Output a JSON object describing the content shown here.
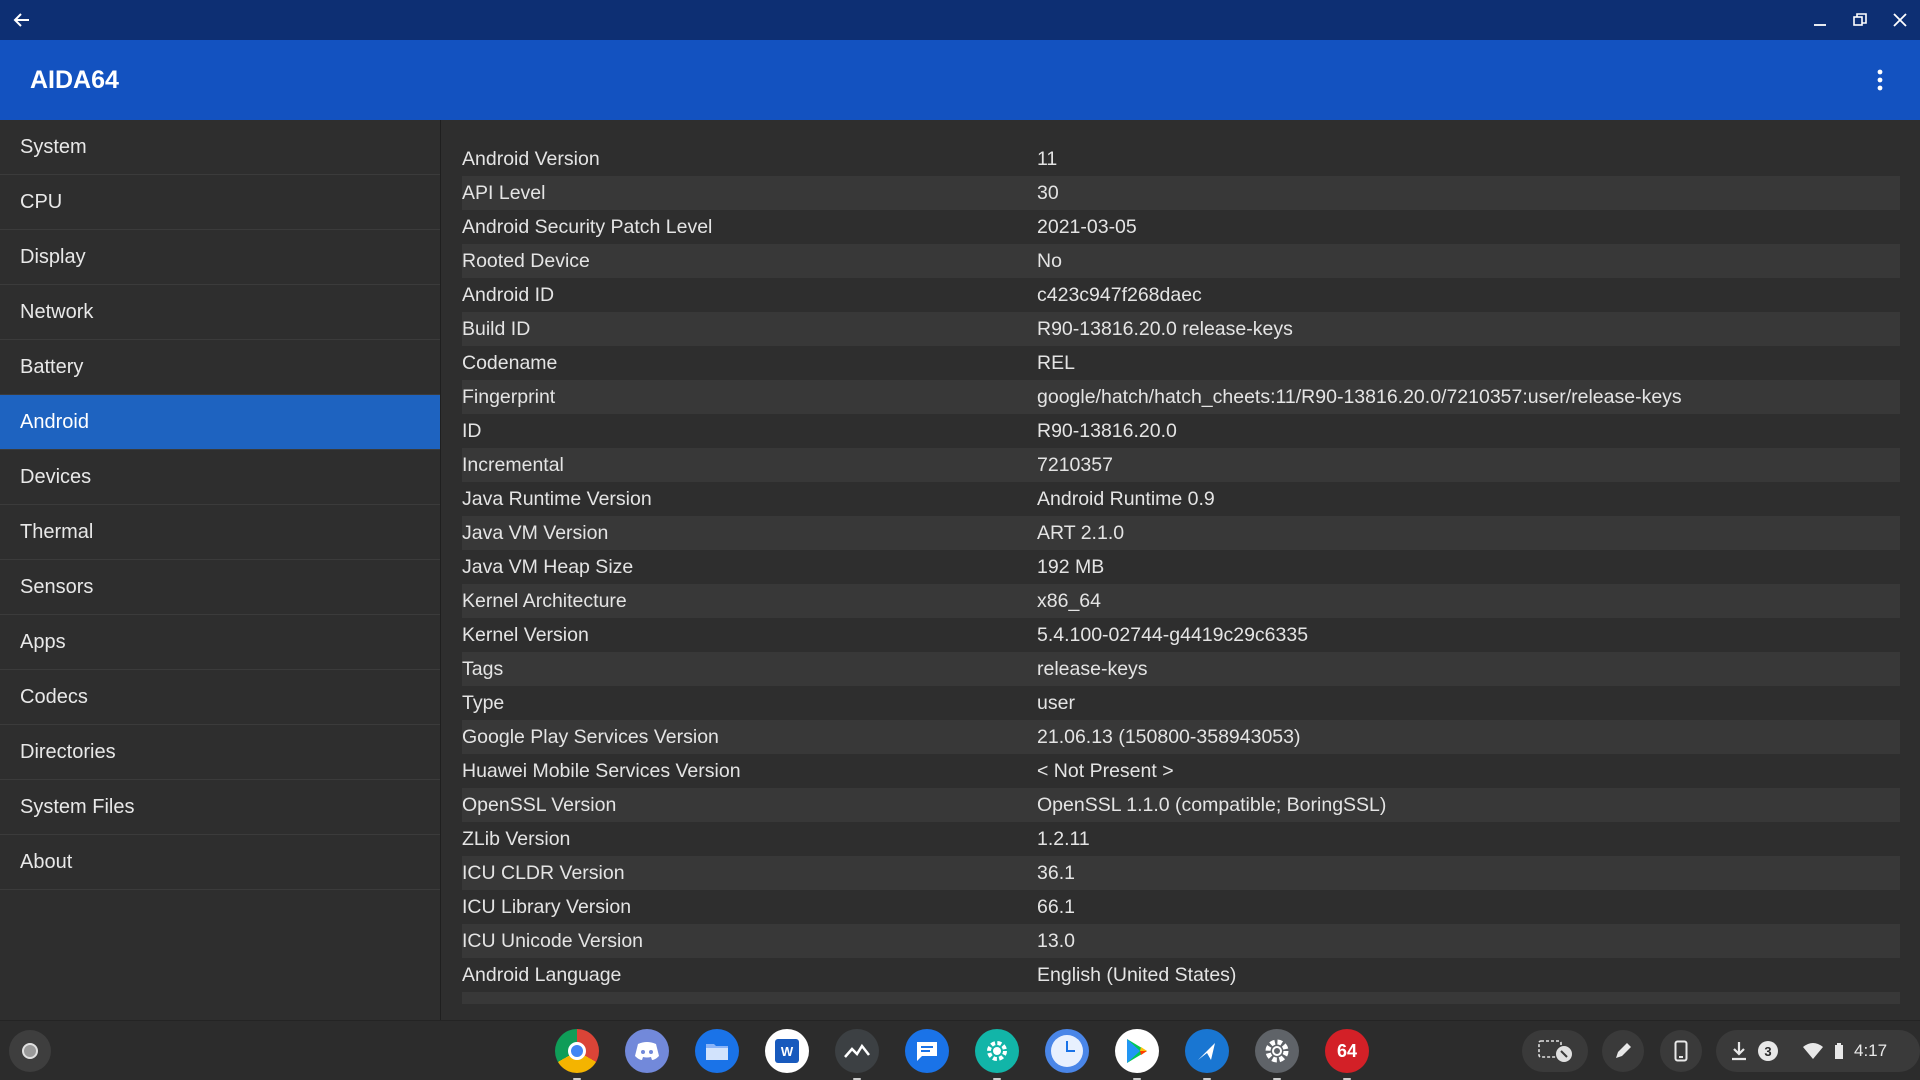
{
  "window": {
    "back_icon": "back-arrow-icon",
    "minimize_icon": "minimize-icon",
    "restore_icon": "restore-icon",
    "close_icon": "close-icon"
  },
  "app_bar": {
    "title": "AIDA64",
    "overflow_icon": "more-vert-icon",
    "color": "#1352c0"
  },
  "sidebar": {
    "items": [
      {
        "label": "System"
      },
      {
        "label": "CPU"
      },
      {
        "label": "Display"
      },
      {
        "label": "Network"
      },
      {
        "label": "Battery"
      },
      {
        "label": "Android",
        "selected": true
      },
      {
        "label": "Devices"
      },
      {
        "label": "Thermal"
      },
      {
        "label": "Sensors"
      },
      {
        "label": "Apps"
      },
      {
        "label": "Codecs"
      },
      {
        "label": "Directories"
      },
      {
        "label": "System Files"
      },
      {
        "label": "About"
      }
    ],
    "selected_color": "#1e63c0"
  },
  "details": [
    {
      "key": "Android Version",
      "value": "11"
    },
    {
      "key": "API Level",
      "value": "30"
    },
    {
      "key": "Android Security Patch Level",
      "value": "2021-03-05"
    },
    {
      "key": "Rooted Device",
      "value": "No"
    },
    {
      "key": "Android ID",
      "value": "c423c947f268daec"
    },
    {
      "key": "Build ID",
      "value": "R90-13816.20.0 release-keys"
    },
    {
      "key": "Codename",
      "value": "REL"
    },
    {
      "key": "Fingerprint",
      "value": "google/hatch/hatch_cheets:11/R90-13816.20.0/7210357:user/release-keys"
    },
    {
      "key": "ID",
      "value": "R90-13816.20.0"
    },
    {
      "key": "Incremental",
      "value": "7210357"
    },
    {
      "key": "Java Runtime Version",
      "value": "Android Runtime 0.9"
    },
    {
      "key": "Java VM Version",
      "value": "ART 2.1.0"
    },
    {
      "key": "Java VM Heap Size",
      "value": "192 MB"
    },
    {
      "key": "Kernel Architecture",
      "value": "x86_64"
    },
    {
      "key": "Kernel Version",
      "value": "5.4.100-02744-g4419c29c6335"
    },
    {
      "key": "Tags",
      "value": "release-keys"
    },
    {
      "key": "Type",
      "value": "user"
    },
    {
      "key": "Google Play Services Version",
      "value": "21.06.13 (150800-358943053)"
    },
    {
      "key": "Huawei Mobile Services Version",
      "value": "< Not Present >"
    },
    {
      "key": "OpenSSL Version",
      "value": "OpenSSL 1.1.0 (compatible; BoringSSL)"
    },
    {
      "key": "ZLib Version",
      "value": "1.2.11"
    },
    {
      "key": "ICU CLDR Version",
      "value": "36.1"
    },
    {
      "key": "ICU Library Version",
      "value": "66.1"
    },
    {
      "key": "ICU Unicode Version",
      "value": "13.0"
    },
    {
      "key": "Android Language",
      "value": "English (United States)"
    }
  ],
  "shelf": {
    "launcher_icon": "launcher-icon",
    "apps": [
      {
        "icon": "chrome-icon",
        "running": true
      },
      {
        "icon": "discord-icon",
        "running": false
      },
      {
        "icon": "files-icon",
        "running": false
      },
      {
        "icon": "word-icon",
        "running": false
      },
      {
        "icon": "stocks-icon",
        "running": true
      },
      {
        "icon": "messages-icon",
        "running": false
      },
      {
        "icon": "android-settings-icon",
        "running": true
      },
      {
        "icon": "clock-icon",
        "running": false
      },
      {
        "icon": "play-store-icon",
        "running": true
      },
      {
        "icon": "maps-icon",
        "running": true
      },
      {
        "icon": "settings-icon",
        "running": true
      },
      {
        "icon": "aida64-icon",
        "label": "64",
        "running": true
      }
    ],
    "tray": {
      "notification_count": "3",
      "time": "4:17"
    }
  }
}
